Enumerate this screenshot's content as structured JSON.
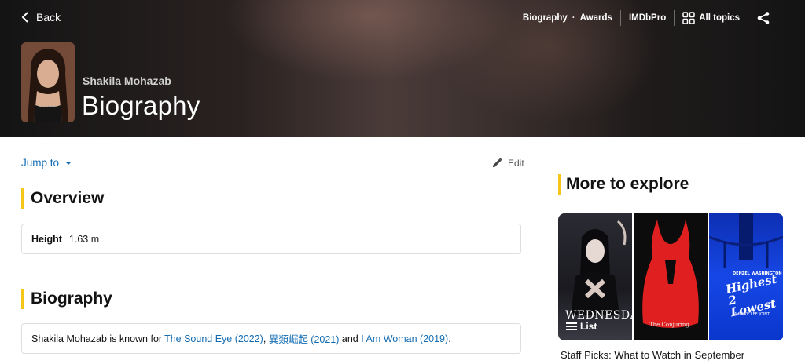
{
  "header": {
    "back_label": "Back",
    "nav": {
      "biography": "Biography",
      "dot": "·",
      "awards": "Awards",
      "imdbpro": "IMDbPro",
      "all_topics": "All topics"
    },
    "person_name": "Shakila Mohazab",
    "page_title": "Biography"
  },
  "main": {
    "jump_to": "Jump to",
    "edit": "Edit",
    "overview_title": "Overview",
    "height_label": "Height",
    "height_value": "1.63 m",
    "biography_title": "Biography",
    "bio": {
      "prefix": "Shakila Mohazab is known for ",
      "titles": [
        "The Sound Eye (2022)",
        "異類崛起 (2021)",
        "I Am Woman (2019)"
      ],
      "sep1": ", ",
      "sep2": " and ",
      "suffix": "."
    }
  },
  "sidebar": {
    "title": "More to explore",
    "list_badge": "List",
    "caption": "Staff Picks: What to Watch in September",
    "posters": {
      "p1_title": "WEDNESDAY",
      "p2_title": "The Conjuring",
      "p3_title": "Highest 2 Lowest",
      "p3_top": "DENZEL WASHINGTON",
      "p3_sub": "A SPIKE LEE JOINT"
    }
  },
  "colors": {
    "accent": "#f5c518",
    "link": "#136cb2"
  }
}
